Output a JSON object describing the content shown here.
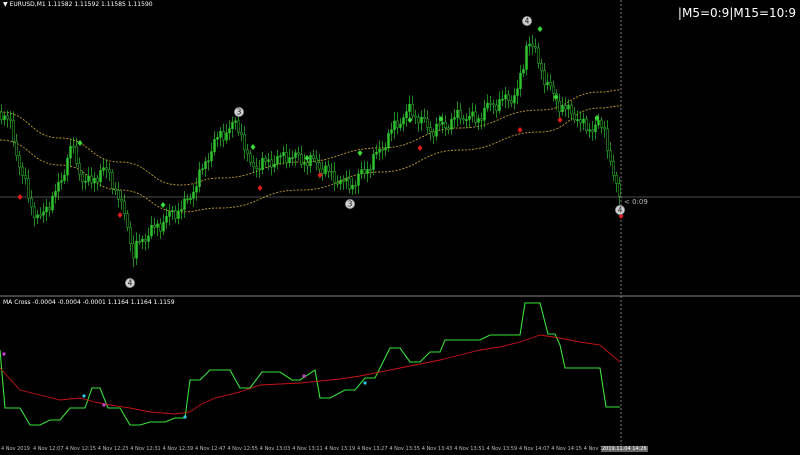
{
  "main_title": "EURUSD,M1  1.11582 1.11592 1.11585 1.11590",
  "indicator_title": "MA Cross -0.0004 -0.0004 -0.0001  1.1164 1.1164 1.1159",
  "timeframe_label": "|M5=0:9|M15=10:9",
  "countdown": "< 0:09",
  "markers": [
    "4",
    "3",
    "3",
    "4",
    "4"
  ],
  "time_axis": {
    "first_label": "4 Nov 2019",
    "labels": [
      "4 Nov 12:07",
      "4 Nov 12:15",
      "4 Nov 12:23",
      "4 Nov 12:31",
      "4 Nov 12:39",
      "4 Nov 12:47",
      "4 Nov 12:55",
      "4 Nov 13:03",
      "4 Nov 13:11",
      "4 Nov 13:19",
      "4 Nov 13:27",
      "4 Nov 13:35",
      "4 Nov 13:43",
      "4 Nov 13:51",
      "4 Nov 13:59",
      "4 Nov 14:07",
      "4 Nov 14:15",
      "4 Nov 14:23"
    ],
    "current_label": "2019.11.04 14:26"
  },
  "colors": {
    "background": "#000000",
    "candle": "#2fc32f",
    "band": "#c8a02a",
    "buy_signal": "#3ad73a",
    "sell_signal": "#e01c1c",
    "fast_line": "#39e339",
    "slow_line": "#c81414",
    "cross_magenta": "#d040d0",
    "cross_cyan": "#30c8e0"
  }
}
